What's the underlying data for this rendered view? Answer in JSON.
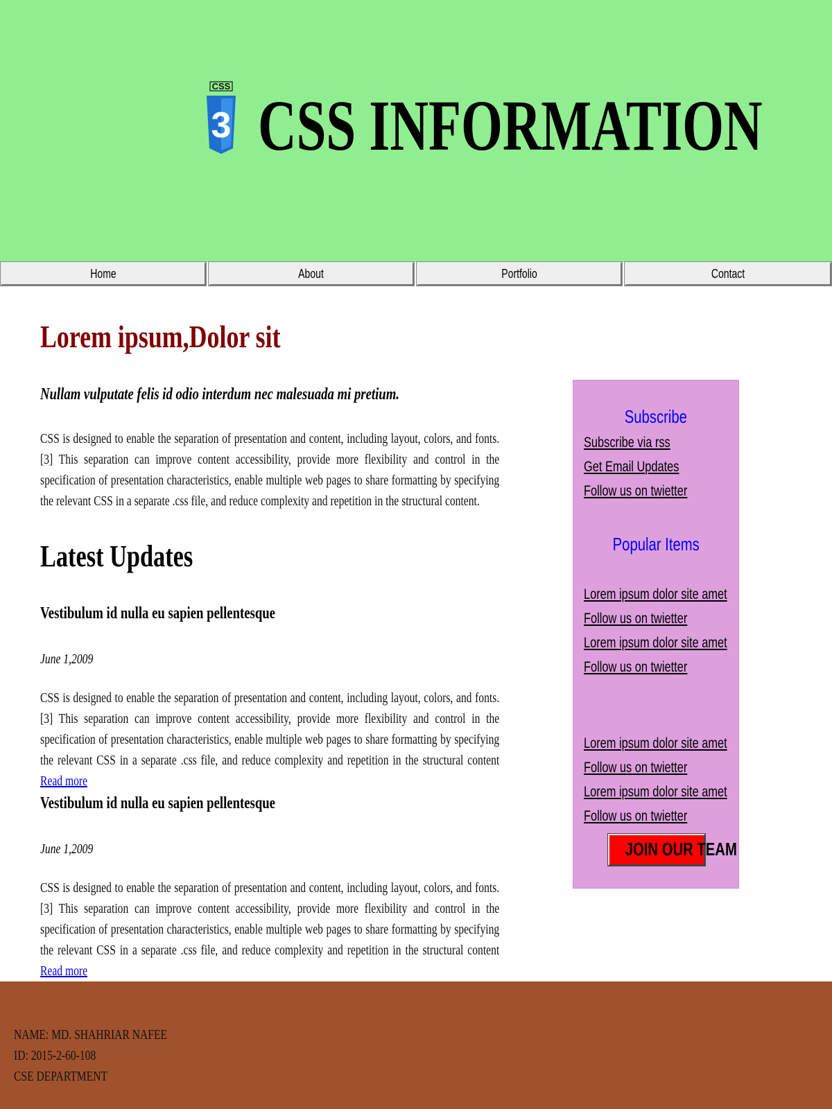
{
  "header": {
    "logo_text": "CSS",
    "logo_number": "3",
    "title": "CSS INFORMATION"
  },
  "nav": {
    "items": [
      {
        "label": "Home"
      },
      {
        "label": "About"
      },
      {
        "label": "Portfolio"
      },
      {
        "label": "Contact"
      }
    ]
  },
  "main": {
    "title": "Lorem ipsum,Dolor sit",
    "subtitle": "Nullam vulputate felis id odio interdum nec malesuada mi pretium.",
    "intro_paragraph": "CSS is designed to enable the separation of presentation and content, including layout, colors, and fonts.[3] This separation can improve content accessibility, provide more flexibility and control in the specification of presentation characteristics, enable multiple web pages to share formatting by specifying the relevant CSS in a separate .css file, and reduce complexity and repetition in the structural content.",
    "updates_title": "Latest Updates",
    "articles": [
      {
        "title": "Vestibulum id nulla eu sapien pellentesque",
        "date": "June 1,2009",
        "body": "CSS is designed to enable the separation of presentation and content, including layout, colors, and fonts.[3] This separation can improve content accessibility, provide more flexibility and control in the specification of presentation characteristics, enable multiple web pages to share formatting by specifying the relevant CSS in a separate .css file, and reduce complexity and repetition in the structural content",
        "read_more": "Read more"
      },
      {
        "title": "Vestibulum id nulla eu sapien pellentesque",
        "date": "June 1,2009",
        "body": "CSS is designed to enable the separation of presentation and content, including layout, colors, and fonts.[3] This separation can improve content accessibility, provide more flexibility and control in the specification of presentation characteristics, enable multiple web pages to share formatting by specifying the relevant CSS in a separate .css file, and reduce complexity and repetition in the structural content",
        "read_more": "Read more"
      }
    ]
  },
  "sidebar": {
    "subscribe_heading": "Subscribe",
    "subscribe_links": [
      "Subscribe via rss",
      "Get Email Updates",
      "Follow us on twietter"
    ],
    "popular_heading": "Popular Items",
    "popular_links": [
      "Lorem ipsum dolor site amet",
      "Follow us on twietter",
      "Lorem ipsum dolor site amet",
      "Follow us on twietter"
    ],
    "more_links": [
      "Lorem ipsum dolor site amet",
      "Follow us on twietter",
      "Lorem ipsum dolor site amet",
      "Follow us on twietter"
    ],
    "join_button": "JOIN OUR TEAM"
  },
  "footer": {
    "name": "NAME: MD. SHAHRIAR NAFEE",
    "id": "ID: 2015-2-60-108",
    "department": "CSE DEPARTMENT"
  },
  "colors": {
    "header_bg": "#90ee90",
    "title_red": "#800000",
    "sidebar_bg": "#dda0dd",
    "sidebar_heading": "#0000ff",
    "join_button_bg": "#ff0000",
    "footer_bg": "#a0522d",
    "logo_blue": "#1f6fcf"
  }
}
